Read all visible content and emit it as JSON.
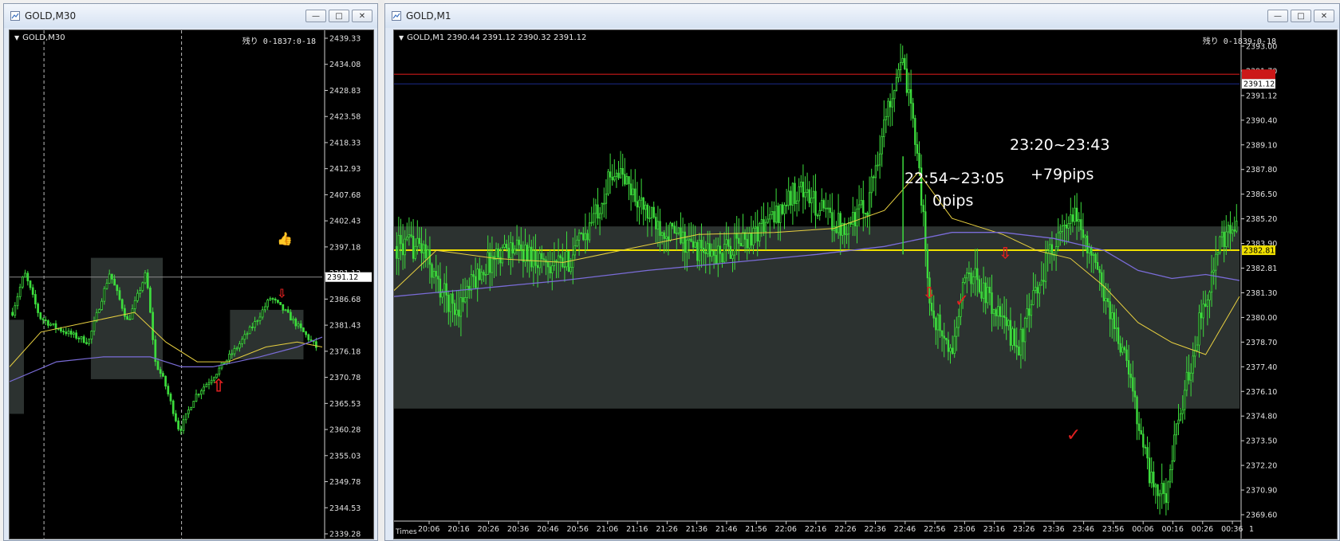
{
  "windows": {
    "m30": {
      "title": "GOLD,M30",
      "symbol_line": "GOLD,M30",
      "remaining": "残り 0-1837:0-18",
      "current_price_tag": "2391.12",
      "price_axis": [
        "2439.33",
        "2434.08",
        "2428.83",
        "2423.58",
        "2418.33",
        "2412.93",
        "2407.68",
        "2402.43",
        "2397.18",
        "2391.12",
        "2386.68",
        "2381.43",
        "2376.18",
        "2370.78",
        "2365.53",
        "2360.28",
        "2355.03",
        "2349.78",
        "2344.53",
        "2339.28"
      ]
    },
    "m1": {
      "title": "GOLD,M1",
      "symbol_line": "GOLD,M1  2390.44  2391.12  2390.32  2391.12",
      "remaining": "残り 0-1839:0-18",
      "bid_tag": "2391.12",
      "level_tag": "2382.81",
      "price_axis": [
        "2393.00",
        "2391.70",
        "2391.12",
        "2390.40",
        "2389.10",
        "2387.80",
        "2386.50",
        "2385.20",
        "2383.90",
        "2382.81",
        "2381.30",
        "2380.00",
        "2378.70",
        "2377.40",
        "2376.10",
        "2374.80",
        "2373.50",
        "2372.20",
        "2370.90",
        "2369.60"
      ],
      "time_axis_label": "Times",
      "time_axis": [
        "20:06",
        "20:16",
        "20:26",
        "20:36",
        "20:46",
        "20:56",
        "21:06",
        "21:16",
        "21:26",
        "21:36",
        "21:46",
        "21:56",
        "22:06",
        "22:16",
        "22:26",
        "22:36",
        "22:46",
        "22:56",
        "23:06",
        "23:16",
        "23:26",
        "23:36",
        "23:46",
        "23:56",
        "00:06",
        "00:16",
        "00:26",
        "00:36"
      ],
      "time_axis_end": "1",
      "annotations": {
        "trade1_time": "22:54~23:05",
        "trade1_result": "0pips",
        "trade2_time": "23:20~23:43",
        "trade2_result": "+79pips"
      }
    }
  },
  "window_buttons": {
    "minimize": "—",
    "maximize": "□",
    "close": "✕"
  },
  "colors": {
    "background": "#000000",
    "bull_candle": "#3ddc3d",
    "fast_ma": "#e8d040",
    "slow_ma": "#7a6cd8",
    "level_line": "#f0e000",
    "resistance_line": "#cc1818",
    "zone": "#2c3230",
    "arrow": "#e02020"
  },
  "icons": [
    "window-icon",
    "thumbs-up-icon",
    "down-arrow-icon",
    "up-arrow-icon",
    "checkmark-icon"
  ]
}
